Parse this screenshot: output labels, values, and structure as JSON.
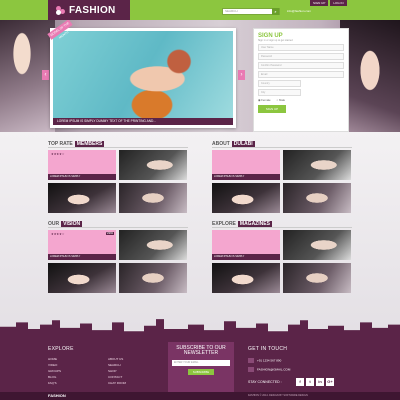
{
  "topbar": {
    "logo": "FASHION",
    "search_placeholder": "SEARCH",
    "email": "info@fashion.com",
    "links": [
      "SIGN UP",
      "LOG IN"
    ]
  },
  "hero": {
    "ribbon": "MODEL OF THE MONTH",
    "caption": "LOREM IPSUM IS SIMPLY DUMMY TEXT OF THE PRINTING AND...",
    "signup": {
      "title": "SIGN UP",
      "subtitle": "Sign in or sign up to get started",
      "fields": [
        "User Name",
        "Password",
        "Confirm Password",
        "Email",
        "Country",
        "City"
      ],
      "gender": [
        "Female",
        "Male"
      ],
      "button": "SIGN UP"
    }
  },
  "panels": [
    {
      "title_plain": "TOP RATE",
      "title_accent": "MEMBERS",
      "tiles": [
        {
          "kind": "pink",
          "stars": "★★★★☆",
          "label": "LOREM IPSUM IS SIMPLY"
        },
        {
          "kind": "photo1"
        },
        {
          "kind": "photo2"
        },
        {
          "kind": "photo3"
        }
      ]
    },
    {
      "title_plain": "ABOUT",
      "title_accent": "DULABI",
      "tiles": [
        {
          "kind": "pink",
          "label": "LOREM IPSUM IS SIMPLY"
        },
        {
          "kind": "photo1"
        },
        {
          "kind": "photo2"
        },
        {
          "kind": "photo3"
        }
      ]
    },
    {
      "title_plain": "OUR",
      "title_accent": "VISION",
      "tiles": [
        {
          "kind": "pink",
          "stars": "★★★★☆",
          "btn": "VIEW",
          "label": "LOREM IPSUM IS SIMPLY"
        },
        {
          "kind": "photo1"
        },
        {
          "kind": "photo2"
        },
        {
          "kind": "photo3"
        }
      ]
    },
    {
      "title_plain": "EXPLORE",
      "title_accent": "MAGAZINES",
      "tiles": [
        {
          "kind": "pink",
          "label": "LOREM IPSUM IS SIMPLY"
        },
        {
          "kind": "photo1"
        },
        {
          "kind": "photo2"
        },
        {
          "kind": "photo3"
        }
      ]
    }
  ],
  "footer": {
    "explore_title": "EXPLORE",
    "explore_col1": [
      "HOME",
      "VIDEO",
      "GROUPS",
      "BLOG",
      "FAQ'S"
    ],
    "explore_col2": [
      "ABOUT US",
      "SEARCH",
      "SHOP",
      "CONTACT",
      "CHAT ROOM"
    ],
    "newsletter_title": "SUBSCRIBE TO OUR NEWSLETTER",
    "newsletter_placeholder": "ENTER YOUR EMAIL",
    "newsletter_button": "SUBSCRIBE",
    "contact_title": "GET IN TOUCH",
    "phone": "+91 1234 567 890",
    "email": "FASHION@GMAIL.COM",
    "stay_connected": "STAY CONNECTED :",
    "social": [
      "f",
      "t",
      "in",
      "G+"
    ],
    "bottom_logo": "FASHION",
    "copyright": "FASHION © 2014. DESIGN BY SOFTWARE DESIGN"
  },
  "colors": {
    "brand": "#5b2448",
    "accent": "#8cc63f",
    "pink": "#f4a6cf"
  }
}
